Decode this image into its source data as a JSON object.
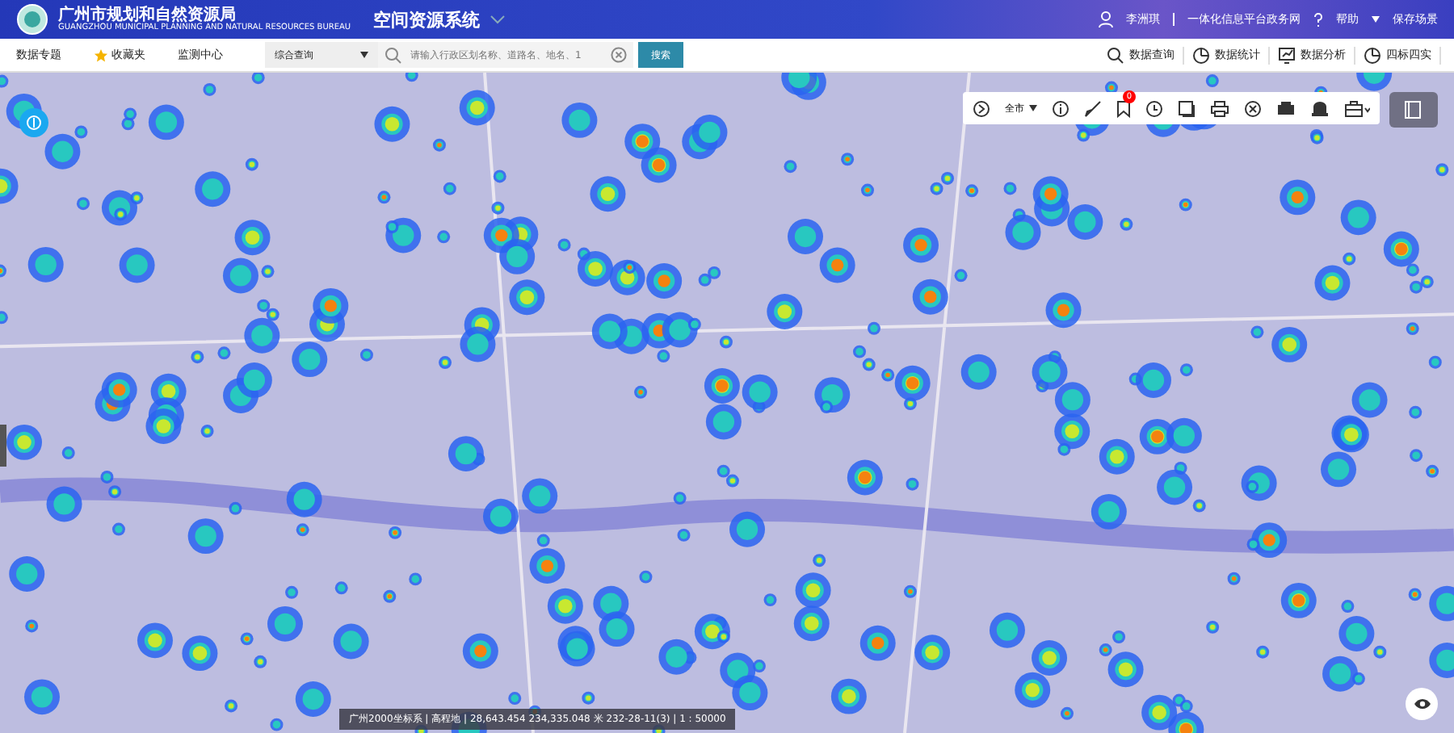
{
  "header": {
    "org_name": "广州市规划和自然资源局",
    "org_name_en": "GUANGZHOU MUNICIPAL PLANNING AND NATURAL RESOURCES BUREAU",
    "system_name": "空间资源系统",
    "user": "李洲琪",
    "portal_link": "一体化信息平台政务网",
    "help": "帮助",
    "save_scene": "保存场景"
  },
  "nav": {
    "items": [
      {
        "label": "数据专题",
        "kind": "plain"
      },
      {
        "label": "收藏夹",
        "kind": "star"
      },
      {
        "label": "监测中心",
        "kind": "plain"
      }
    ],
    "search_scope": "综合查询",
    "search_placeholder": "请输入行政区划名称、道路名、地名、1",
    "search_button": "搜索",
    "tools": [
      {
        "label": "数据查询",
        "kind": "search"
      },
      {
        "label": "数据统计",
        "kind": "pie"
      },
      {
        "label": "数据分析",
        "kind": "chart"
      },
      {
        "label": "四标四实",
        "kind": "pie"
      }
    ]
  },
  "map_toolbar": {
    "region": "全市",
    "bookmark_count": "0"
  },
  "status_bar": {
    "text": "广州2000坐标系 | 高程地 | 28,643.454 234,335.048 米 232-28-11(3) | 1 : 50000"
  }
}
